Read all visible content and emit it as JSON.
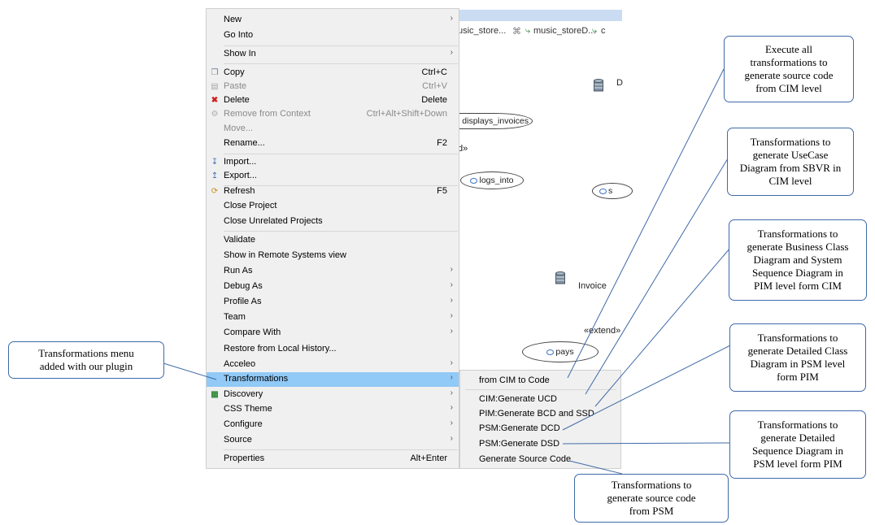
{
  "editor": {
    "tabs": [
      "usic_store...",
      "⌘",
      "music_storeD...",
      "c"
    ],
    "diagram": {
      "node_displays_invoices": "displays_invoices",
      "fragment_d": "d»",
      "node_logs_into": "logs_into",
      "node_s": "s",
      "label_D": "D",
      "label_invoice": "Invoice",
      "label_extend": "«extend»",
      "node_pays": "pays"
    }
  },
  "menu": {
    "items": [
      {
        "label": "New",
        "arrow": "›"
      },
      {
        "label": "Go Into"
      },
      {
        "label": "Show In",
        "arrow": "›"
      },
      {
        "label": "Copy",
        "shortcut": "Ctrl+C",
        "icon": "copy-icon"
      },
      {
        "label": "Paste",
        "shortcut": "Ctrl+V",
        "icon": "paste-icon"
      },
      {
        "label": "Delete",
        "shortcut": "Delete",
        "icon": "delete-icon"
      },
      {
        "label": "Remove from Context",
        "shortcut": "Ctrl+Alt+Shift+Down",
        "icon": "remove-context-icon"
      },
      {
        "label": "Move..."
      },
      {
        "label": "Rename...",
        "shortcut": "F2"
      },
      {
        "label": "Import...",
        "icon": "import-icon"
      },
      {
        "label": "Export...",
        "icon": "export-icon"
      },
      {
        "label": "Refresh",
        "shortcut": "F5",
        "icon": "refresh-icon"
      },
      {
        "label": "Close Project"
      },
      {
        "label": "Close Unrelated Projects"
      },
      {
        "label": "Validate"
      },
      {
        "label": "Show in Remote Systems view"
      },
      {
        "label": "Run As",
        "arrow": "›"
      },
      {
        "label": "Debug As",
        "arrow": "›"
      },
      {
        "label": "Profile As",
        "arrow": "›"
      },
      {
        "label": "Team",
        "arrow": "›"
      },
      {
        "label": "Compare With",
        "arrow": "›"
      },
      {
        "label": "Restore from Local History..."
      },
      {
        "label": "Acceleo",
        "arrow": "›"
      },
      {
        "label": "Transformations",
        "arrow": "›"
      },
      {
        "label": "Discovery",
        "arrow": "›",
        "icon": "discovery-icon"
      },
      {
        "label": "CSS Theme",
        "arrow": "›"
      },
      {
        "label": "Configure",
        "arrow": "›"
      },
      {
        "label": "Source",
        "arrow": "›"
      },
      {
        "label": "Properties",
        "shortcut": "Alt+Enter"
      }
    ]
  },
  "submenu": {
    "items": [
      "from CIM to Code",
      "CIM:Generate UCD",
      "PIM:Generate BCD and SSD",
      "PSM:Generate DCD",
      "PSM:Generate DSD",
      "Generate Source Code"
    ]
  },
  "callouts": {
    "menu_note": [
      "Transformations menu",
      "added with our plugin"
    ],
    "cim_to_code": [
      "Execute all",
      "transformations to",
      "generate source code",
      "from CIM level"
    ],
    "ucd": [
      "Transformations to",
      "generate UseCase",
      "Diagram from SBVR  in",
      "CIM level"
    ],
    "bcd_ssd": [
      "Transformations to",
      "generate Business Class",
      "Diagram and System",
      "Sequence Diagram in",
      "PIM level form CIM"
    ],
    "dcd": [
      "Transformations to",
      "generate Detailed Class",
      "Diagram  in PSM level",
      "form PIM"
    ],
    "dsd": [
      "Transformations to",
      "generate Detailed",
      "Sequence Diagram  in",
      "PSM level form PIM"
    ],
    "source": [
      "Transformations to",
      "generate source code",
      "from PSM"
    ]
  },
  "colors": {
    "highlight": "#91c9f7",
    "callout_border": "#3f6aa8",
    "menu_bg": "#f0f0f0"
  }
}
